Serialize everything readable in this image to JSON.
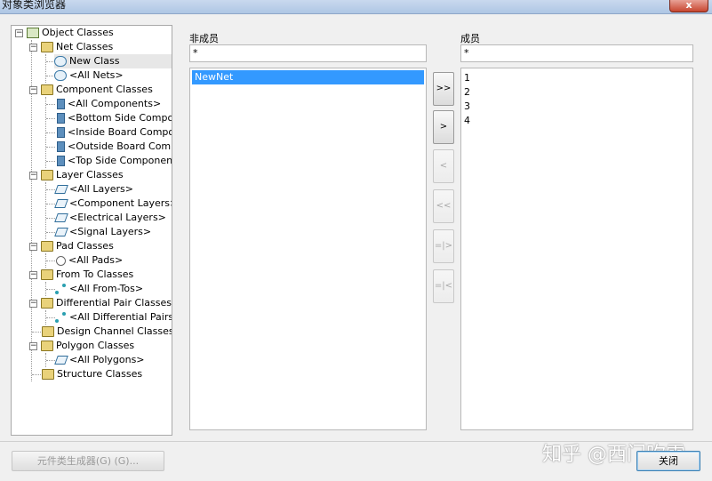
{
  "window": {
    "title": "对象类浏览器",
    "close_glyph": "x"
  },
  "tree": {
    "root": "Object Classes",
    "groups": [
      {
        "label": "Net Classes",
        "items": [
          "New Class",
          "<All Nets>"
        ]
      },
      {
        "label": "Component Classes",
        "items": [
          "<All Components>",
          "<Bottom Side Compon",
          "<Inside Board Compo",
          "<Outside Board Comp",
          "<Top Side Componen"
        ]
      },
      {
        "label": "Layer Classes",
        "items": [
          "<All Layers>",
          "<Component Layers>",
          "<Electrical Layers>",
          "<Signal Layers>"
        ]
      },
      {
        "label": "Pad Classes",
        "items": [
          "<All Pads>"
        ]
      },
      {
        "label": "From To Classes",
        "items": [
          "<All From-Tos>"
        ]
      },
      {
        "label": "Differential Pair Classes",
        "items": [
          "<All Differential Pairs>"
        ]
      },
      {
        "label": "Design Channel Classes",
        "items": []
      },
      {
        "label": "Polygon Classes",
        "items": [
          "<All Polygons>"
        ]
      },
      {
        "label": "Structure Classes",
        "items": []
      }
    ]
  },
  "non_members": {
    "label": "非成员",
    "filter": "*",
    "items": [
      "NewNet"
    ]
  },
  "members": {
    "label": "成员",
    "filter": "*",
    "items": [
      "1",
      "2",
      "3",
      "4"
    ]
  },
  "transfer": {
    "add_all": ">>",
    "add": ">",
    "remove": "<",
    "remove_all": "<<",
    "add_special": "=|>",
    "remove_special": "=|<"
  },
  "footer": {
    "generator_button": "元件类生成器(G) (G)...",
    "close_button": "关闭"
  },
  "watermark": "知乎 @西门吹雪"
}
